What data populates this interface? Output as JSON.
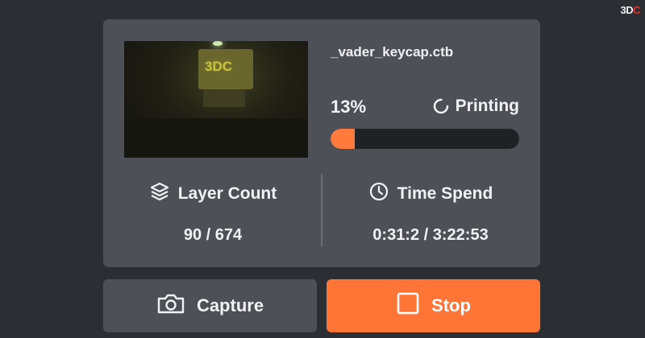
{
  "brand": {
    "logo_prefix": "3D",
    "logo_suffix": "C"
  },
  "job": {
    "filename": "_vader_keycap.ctb",
    "percent_text": "13%",
    "progress": 0.13,
    "status": "Printing"
  },
  "camera": {
    "overlay_text": "3DC"
  },
  "stats": {
    "layers": {
      "label": "Layer Count",
      "value": "90 / 674"
    },
    "time": {
      "label": "Time Spend",
      "value": "0:31:2 / 3:22:53"
    }
  },
  "actions": {
    "capture": "Capture",
    "stop": "Stop"
  },
  "colors": {
    "accent": "#ff7535",
    "card": "#4d5056",
    "background": "#2b2e33",
    "track": "#1f2125"
  },
  "icons": {
    "status": "spinner-icon",
    "layers": "layers-icon",
    "time": "clock-icon",
    "capture": "camera-icon",
    "stop": "stop-square-icon"
  }
}
